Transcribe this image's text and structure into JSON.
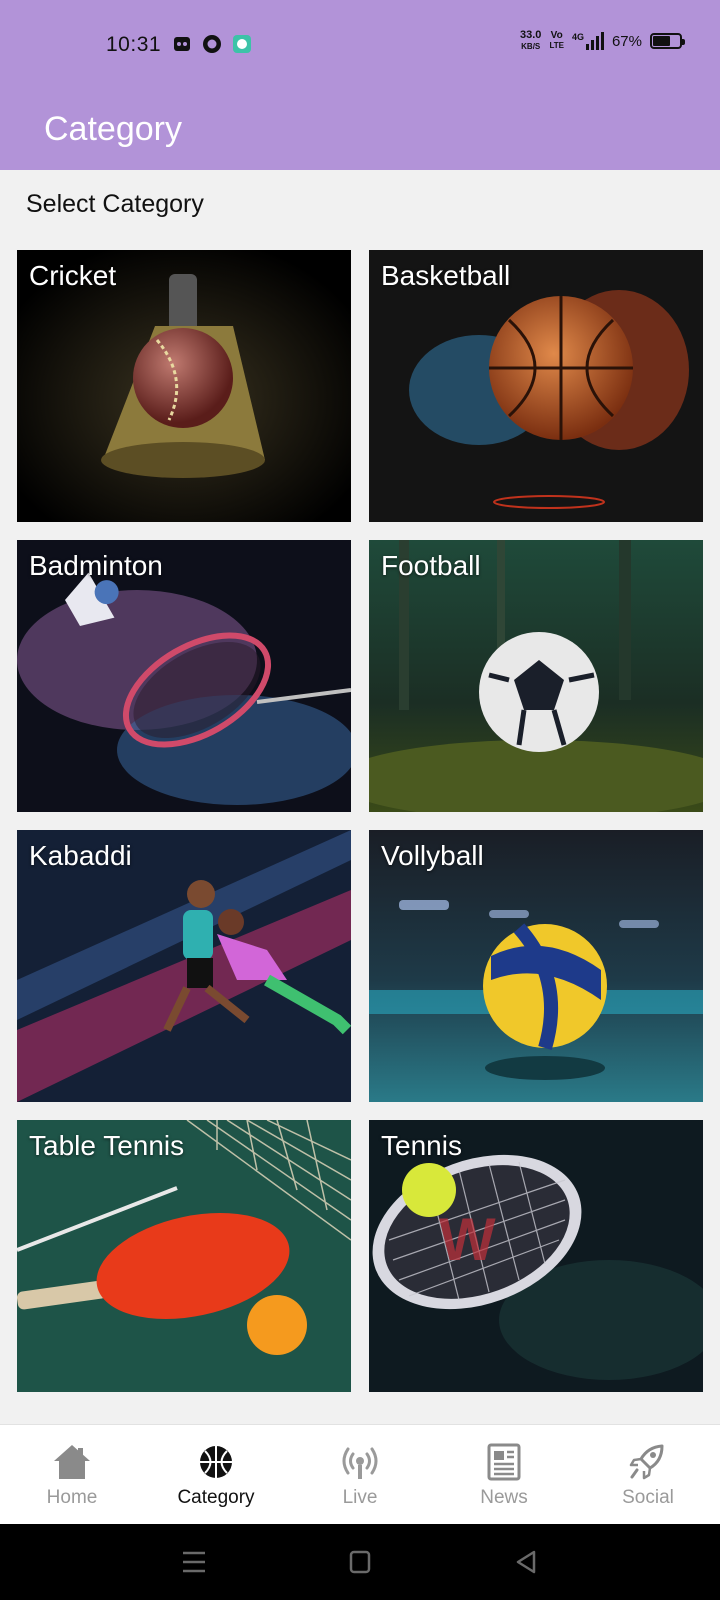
{
  "status_bar": {
    "time": "10:31",
    "speed_top": "33.0",
    "speed_bottom": "KB/S",
    "volte_top": "Vo",
    "volte_bottom": "LTE",
    "network": "4G",
    "battery": "67%",
    "battery_level": 0.67
  },
  "app_bar": {
    "title": "Category"
  },
  "section_title": "Select Category",
  "categories": [
    {
      "label": "Cricket"
    },
    {
      "label": "Basketball"
    },
    {
      "label": "Badminton"
    },
    {
      "label": "Football"
    },
    {
      "label": "Kabaddi"
    },
    {
      "label": "Vollyball"
    },
    {
      "label": "Table Tennis"
    },
    {
      "label": "Tennis"
    }
  ],
  "bottom_nav": [
    {
      "label": "Home",
      "icon": "home-icon",
      "active": false
    },
    {
      "label": "Category",
      "icon": "basketball-icon",
      "active": true
    },
    {
      "label": "Live",
      "icon": "broadcast-icon",
      "active": false
    },
    {
      "label": "News",
      "icon": "newspaper-icon",
      "active": false
    },
    {
      "label": "Social",
      "icon": "rocket-icon",
      "active": false
    }
  ],
  "colors": {
    "accent": "#b293d8",
    "active_nav": "#111111",
    "inactive_nav": "#9a9a9a"
  }
}
